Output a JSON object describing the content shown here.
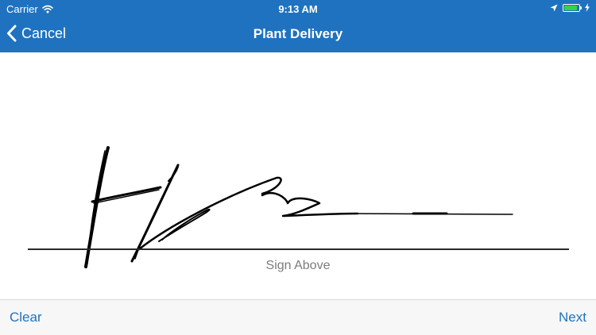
{
  "status_bar": {
    "carrier": "Carrier",
    "time": "9:13 AM",
    "battery_level": 0.9,
    "icons": [
      "wifi-icon",
      "location-arrow-icon",
      "battery-icon",
      "charging-bolt-icon"
    ]
  },
  "nav": {
    "cancel_label": "Cancel",
    "title": "Plant Delivery",
    "back_icon": "chevron-left-icon"
  },
  "signature": {
    "label": "Sign Above"
  },
  "toolbar": {
    "clear_label": "Clear",
    "next_label": "Next"
  },
  "colors": {
    "nav_background": "#1f72bf",
    "accent": "#1f72bf",
    "battery_fill": "#35d04c",
    "ink": "#000000",
    "toolbar_background": "#f7f7f7"
  }
}
